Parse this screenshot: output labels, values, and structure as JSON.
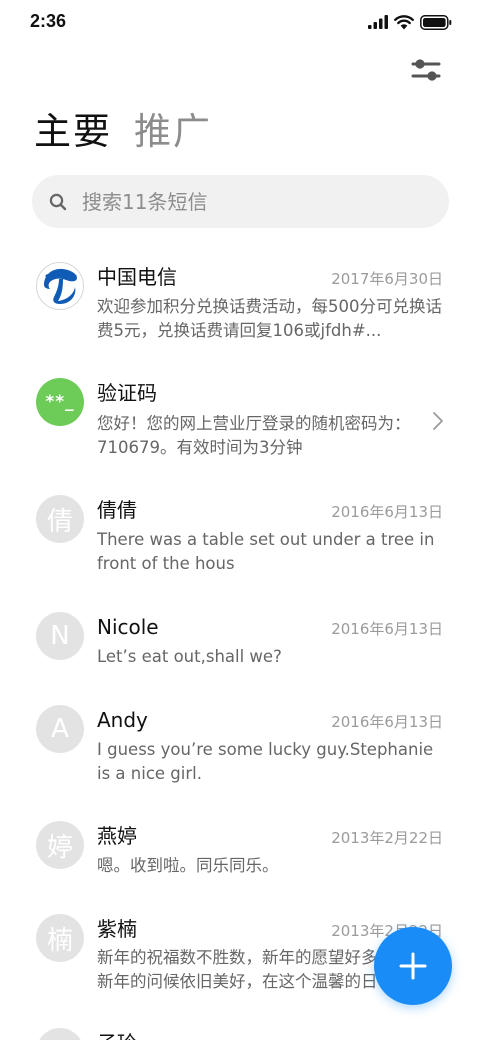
{
  "status_bar": {
    "time": "2:36",
    "icons": [
      "signal-icon",
      "wifi-icon",
      "battery-icon"
    ]
  },
  "toolbar": {
    "filter_icon": "filter-sliders-icon"
  },
  "tabs": [
    {
      "label": "主要",
      "active": true
    },
    {
      "label": "推广",
      "active": false
    }
  ],
  "search": {
    "placeholder": "搜索11条短信",
    "icon": "search-icon"
  },
  "messages": [
    {
      "sender": "中国电信",
      "date": "2017年6月30日",
      "preview": "欢迎参加积分兑换话费活动，每500分可兑换话费5元，兑换话费请回复106或jfdh#...",
      "avatar": {
        "type": "logo",
        "icon": "china-telecom-logo"
      }
    },
    {
      "sender": "验证码",
      "date": "",
      "preview": "您好！您的网上营业厅登录的随机密码为：710679。有效时间为3分钟",
      "avatar": {
        "type": "text",
        "text": "**_",
        "color": "#6ccc57"
      },
      "chevron": true
    },
    {
      "sender": "倩倩",
      "date": "2016年6月13日",
      "preview": "There was a table set out under a tree in front of the hous",
      "avatar": {
        "type": "text",
        "text": "倩",
        "color": "#e3e3e3"
      }
    },
    {
      "sender": "Nicole",
      "date": "2016年6月13日",
      "preview": "Let’s eat out,shall we?",
      "avatar": {
        "type": "text",
        "text": "N",
        "color": "#e3e3e3"
      }
    },
    {
      "sender": "Andy",
      "date": "2016年6月13日",
      "preview": "I guess you’re some lucky guy.Stephanie is a nice girl.",
      "avatar": {
        "type": "text",
        "text": "A",
        "color": "#e3e3e3"
      }
    },
    {
      "sender": "燕婷",
      "date": "2013年2月22日",
      "preview": "嗯。收到啦。同乐同乐。",
      "avatar": {
        "type": "text",
        "text": "婷",
        "color": "#e3e3e3"
      }
    },
    {
      "sender": "紫楠",
      "date": "2013年2月22日",
      "preview": "新年的祝福数不胜数，新年的愿望好多好多，新年的问候依旧美好，在这个温馨的日子",
      "avatar": {
        "type": "text",
        "text": "楠",
        "color": "#e3e3e3"
      }
    },
    {
      "sender": "子玲",
      "date": "",
      "preview": "",
      "avatar": {
        "type": "text",
        "text": "",
        "color": "#e3e3e3"
      }
    }
  ],
  "fab": {
    "icon": "plus-icon",
    "color": "#1a8cf7"
  },
  "colors": {
    "accent": "#1a8cf7",
    "search_bg": "#f1f1f1",
    "date_text": "#9b9b9b",
    "preview_text": "#666666"
  }
}
